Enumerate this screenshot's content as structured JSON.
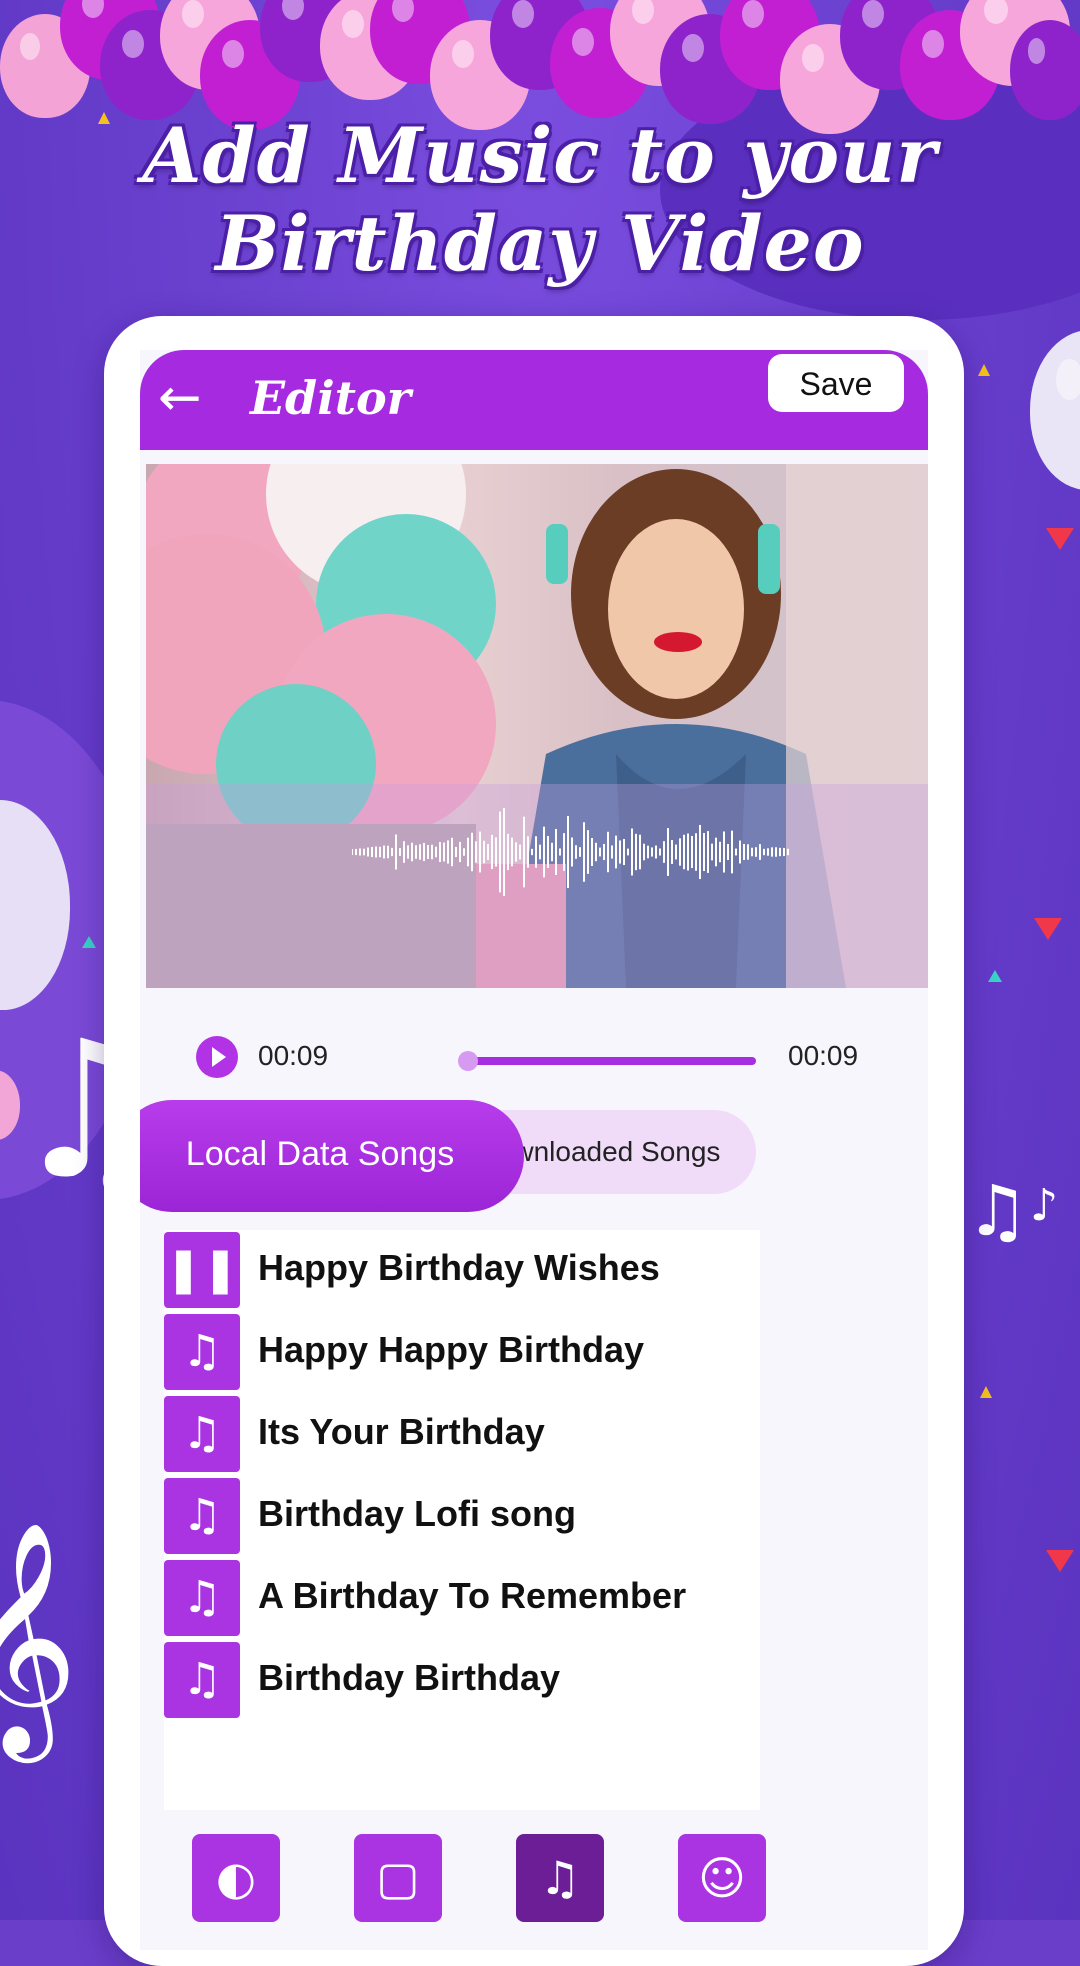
{
  "colors": {
    "accent": "#a62be0",
    "background": "#6a3ec9",
    "tab_inactive": "#f0dcf9",
    "active_tool": "#6b1e96"
  },
  "headline": {
    "line1": "Add Music to your",
    "line2": "Birthday Video"
  },
  "editor": {
    "title": "Editor",
    "back_icon": "arrow-left-icon",
    "save_label": "Save"
  },
  "player": {
    "current_time": "00:09",
    "total_time": "00:09",
    "progress": 0.0
  },
  "tabs": [
    {
      "label": "Local Data Songs",
      "selected": true
    },
    {
      "label": "Downloaded Songs",
      "selected": false
    }
  ],
  "songs": [
    {
      "title": "Happy Birthday Wishes",
      "icon": "pause-icon",
      "playing": true
    },
    {
      "title": "Happy Happy Birthday",
      "icon": "music-note-icon",
      "playing": false
    },
    {
      "title": "Its Your Birthday",
      "icon": "music-note-icon",
      "playing": false
    },
    {
      "title": "Birthday Lofi song",
      "icon": "music-note-icon",
      "playing": false
    },
    {
      "title": "A Birthday To Remember",
      "icon": "music-note-icon",
      "playing": false
    },
    {
      "title": "Birthday Birthday",
      "icon": "music-note-icon",
      "playing": false
    }
  ],
  "tools": [
    {
      "icon": "filter-icon",
      "active": false
    },
    {
      "icon": "frame-icon",
      "active": false
    },
    {
      "icon": "music-icon",
      "active": true
    },
    {
      "icon": "sticker-icon",
      "active": false
    }
  ]
}
